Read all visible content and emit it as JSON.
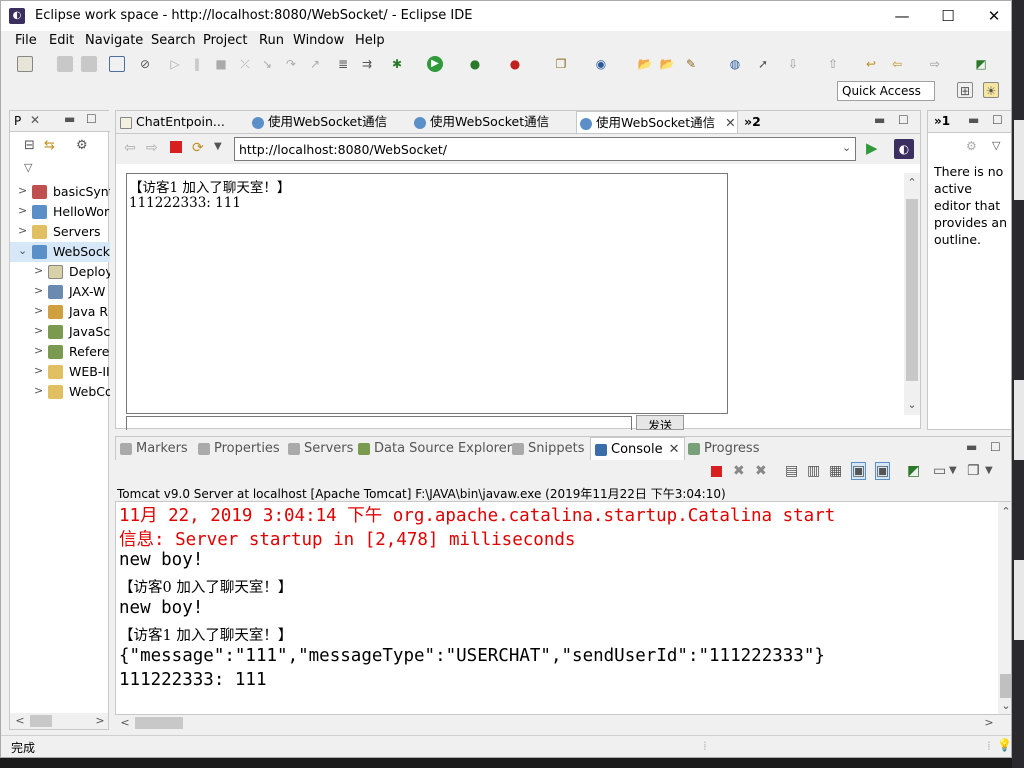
{
  "window": {
    "title": "Eclipse work space - http://localhost:8080/WebSocket/ - Eclipse IDE",
    "minimize": "—",
    "maximize": "☐",
    "close": "✕"
  },
  "menu": [
    "File",
    "Edit",
    "Navigate",
    "Search",
    "Project",
    "Run",
    "Window",
    "Help"
  ],
  "toolbar": {
    "quick_access": "Quick Access"
  },
  "left_panel": {
    "tab_label": "P",
    "tree": [
      {
        "label": "basicSynt",
        "expanded": false
      },
      {
        "label": "HelloWor",
        "expanded": false
      },
      {
        "label": "Servers",
        "expanded": false
      },
      {
        "label": "WebSock",
        "expanded": true
      },
      {
        "label": "Deploy",
        "expanded": false
      },
      {
        "label": "JAX-W",
        "expanded": false
      },
      {
        "label": "Java R",
        "expanded": false
      },
      {
        "label": "JavaSc",
        "expanded": false
      },
      {
        "label": "Refere",
        "expanded": false
      },
      {
        "label": "WEB-II",
        "expanded": false
      },
      {
        "label": "WebCo",
        "expanded": false
      }
    ]
  },
  "editor": {
    "tabs": [
      {
        "label": "ChatEntpoin...",
        "active": false
      },
      {
        "label": "使用WebSocket通信",
        "active": false
      },
      {
        "label": "使用WebSocket通信",
        "active": false
      },
      {
        "label": "使用WebSocket通信",
        "active": true
      }
    ],
    "overflow": "»2",
    "url": "http://localhost:8080/WebSocket/",
    "chat_lines": [
      "【访客1 加入了聊天室！】",
      "111222333: 111"
    ],
    "send_label": "发送"
  },
  "outline": {
    "overflow": "»1",
    "message": "There is no active editor that provides an outline."
  },
  "console": {
    "tabs": [
      {
        "label": "Markers",
        "active": false
      },
      {
        "label": "Properties",
        "active": false
      },
      {
        "label": "Servers",
        "active": false
      },
      {
        "label": "Data Source Explorer",
        "active": false
      },
      {
        "label": "Snippets",
        "active": false
      },
      {
        "label": "Console",
        "active": true
      },
      {
        "label": "Progress",
        "active": false
      }
    ],
    "description": "Tomcat v9.0 Server at localhost [Apache Tomcat] F:\\JAVA\\bin\\javaw.exe (2019年11月22日 下午3:04:10)",
    "lines": [
      {
        "text": "11月 22, 2019 3:04:14 下午 org.apache.catalina.startup.Catalina start",
        "style": "red"
      },
      {
        "text": "信息: Server startup in [2,478] milliseconds",
        "style": "red"
      },
      {
        "text": "new boy!",
        "style": "mono"
      },
      {
        "text": "【访客0 加入了聊天室！】",
        "style": "cn"
      },
      {
        "text": "new boy!",
        "style": "mono"
      },
      {
        "text": "【访客1 加入了聊天室！】",
        "style": "cn"
      },
      {
        "text": "{\"message\":\"111\",\"messageType\":\"USERCHAT\",\"sendUserId\":\"111222333\"}",
        "style": "mono"
      },
      {
        "text": "111222333: 111",
        "style": "mono"
      }
    ]
  },
  "status_bar": {
    "text": "完成"
  }
}
